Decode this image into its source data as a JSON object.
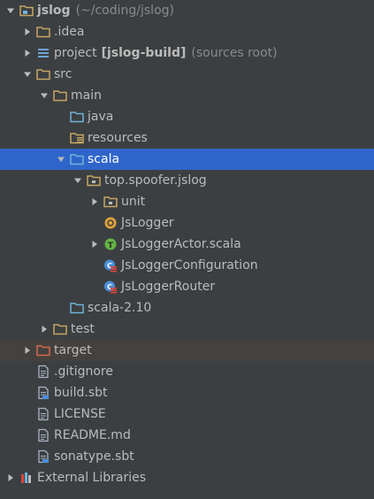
{
  "tree": {
    "items": [
      {
        "label": "jslog",
        "hint": "(~/coding/jslog)",
        "bold": true,
        "depth": 0,
        "arrow": "down",
        "icon": "module-folder-icon",
        "name": "tree-item-jslog"
      },
      {
        "label": ".idea",
        "hint": "",
        "bold": false,
        "depth": 1,
        "arrow": "right",
        "icon": "folder-icon",
        "name": "tree-item-idea"
      },
      {
        "label": "project",
        "hint": "(sources root)",
        "bracket": "[jslog-build]",
        "bold": false,
        "depth": 1,
        "arrow": "right",
        "icon": "source-list-icon",
        "name": "tree-item-project"
      },
      {
        "label": "src",
        "hint": "",
        "bold": false,
        "depth": 1,
        "arrow": "down",
        "icon": "folder-icon",
        "name": "tree-item-src"
      },
      {
        "label": "main",
        "hint": "",
        "bold": false,
        "depth": 2,
        "arrow": "down",
        "icon": "folder-icon",
        "name": "tree-item-main"
      },
      {
        "label": "java",
        "hint": "",
        "bold": false,
        "depth": 3,
        "arrow": "none",
        "icon": "source-folder-icon",
        "name": "tree-item-java"
      },
      {
        "label": "resources",
        "hint": "",
        "bold": false,
        "depth": 3,
        "arrow": "none",
        "icon": "resources-folder-icon",
        "name": "tree-item-resources"
      },
      {
        "label": "scala",
        "hint": "",
        "bold": false,
        "depth": 3,
        "arrow": "down",
        "icon": "source-folder-icon",
        "name": "tree-item-scala",
        "selected": true
      },
      {
        "label": "top.spoofer.jslog",
        "hint": "",
        "bold": false,
        "depth": 4,
        "arrow": "down",
        "icon": "package-icon",
        "name": "tree-item-package"
      },
      {
        "label": "unit",
        "hint": "",
        "bold": false,
        "depth": 5,
        "arrow": "right",
        "icon": "package-icon",
        "name": "tree-item-unit"
      },
      {
        "label": "JsLogger",
        "hint": "",
        "bold": false,
        "depth": 5,
        "arrow": "none",
        "icon": "object-icon",
        "name": "tree-item-jslogger"
      },
      {
        "label": "JsLoggerActor.scala",
        "hint": "",
        "bold": false,
        "depth": 5,
        "arrow": "right",
        "icon": "trait-icon",
        "name": "tree-item-jsloggeractor"
      },
      {
        "label": "JsLoggerConfiguration",
        "hint": "",
        "bold": false,
        "depth": 5,
        "arrow": "none",
        "icon": "scala-class-icon",
        "name": "tree-item-jsloggerconfiguration"
      },
      {
        "label": "JsLoggerRouter",
        "hint": "",
        "bold": false,
        "depth": 5,
        "arrow": "none",
        "icon": "scala-class-icon",
        "name": "tree-item-jsloggerrouter"
      },
      {
        "label": "scala-2.10",
        "hint": "",
        "bold": false,
        "depth": 3,
        "arrow": "none",
        "icon": "source-folder-icon",
        "name": "tree-item-scala-210"
      },
      {
        "label": "test",
        "hint": "",
        "bold": false,
        "depth": 2,
        "arrow": "right",
        "icon": "folder-icon",
        "name": "tree-item-test"
      },
      {
        "label": "target",
        "hint": "",
        "bold": false,
        "depth": 1,
        "arrow": "right",
        "icon": "excluded-folder-icon",
        "name": "tree-item-target",
        "excluded": true
      },
      {
        "label": ".gitignore",
        "hint": "",
        "bold": false,
        "depth": 1,
        "arrow": "none",
        "icon": "text-file-icon",
        "name": "tree-item-gitignore"
      },
      {
        "label": "build.sbt",
        "hint": "",
        "bold": false,
        "depth": 1,
        "arrow": "none",
        "icon": "sbt-file-icon",
        "name": "tree-item-build-sbt"
      },
      {
        "label": "LICENSE",
        "hint": "",
        "bold": false,
        "depth": 1,
        "arrow": "none",
        "icon": "text-file-icon",
        "name": "tree-item-license"
      },
      {
        "label": "README.md",
        "hint": "",
        "bold": false,
        "depth": 1,
        "arrow": "none",
        "icon": "text-file-icon",
        "name": "tree-item-readme"
      },
      {
        "label": "sonatype.sbt",
        "hint": "",
        "bold": false,
        "depth": 1,
        "arrow": "none",
        "icon": "sbt-file-icon",
        "name": "tree-item-sonatype-sbt"
      },
      {
        "label": "External Libraries",
        "hint": "",
        "bold": false,
        "depth": 0,
        "arrow": "right",
        "icon": "libraries-icon",
        "name": "tree-item-external-libraries"
      }
    ]
  },
  "colors": {
    "background": "#3c3f41",
    "selection": "#2f65ca",
    "excluded_row": "#45413e",
    "text": "#bbbbbb",
    "hint": "#8a8a8a",
    "folder": "#c6a664",
    "source_folder": "#6fb3d8",
    "excluded_folder": "#d26a4f",
    "object": "#e0a33a",
    "trait": "#62b543",
    "class": "#4a90d9"
  }
}
